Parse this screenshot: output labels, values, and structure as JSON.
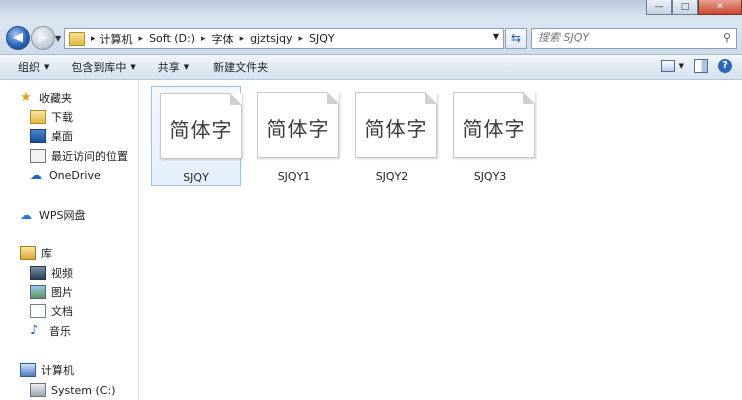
{
  "window": {
    "caption_buttons": [
      "—",
      "□",
      "✕"
    ]
  },
  "address": {
    "crumbs": [
      "计算机",
      "Soft (D:)",
      "字体",
      "gjztsjqy",
      "SJQY"
    ]
  },
  "search": {
    "placeholder": "搜索 SJQY"
  },
  "toolbar": {
    "organize": "组织",
    "include_library": "包含到库中",
    "share": "共享",
    "new_folder": "新建文件夹"
  },
  "nav": {
    "favorites": "收藏夹",
    "downloads": "下载",
    "desktop": "桌面",
    "recent": "最近访问的位置",
    "onedrive": "OneDrive",
    "wps": "WPS网盘",
    "libraries": "库",
    "videos": "视频",
    "pictures": "图片",
    "documents": "文档",
    "music": "音乐",
    "computer": "计算机",
    "system_c": "System (C:)"
  },
  "files": [
    {
      "name": "SJQY",
      "preview": "简体字"
    },
    {
      "name": "SJQY1",
      "preview": "简体字"
    },
    {
      "name": "SJQY2",
      "preview": "简体字"
    },
    {
      "name": "SJQY3",
      "preview": "简体字"
    }
  ],
  "colors": {
    "accent": "#2b66b8",
    "selection": "#99c2ea"
  }
}
